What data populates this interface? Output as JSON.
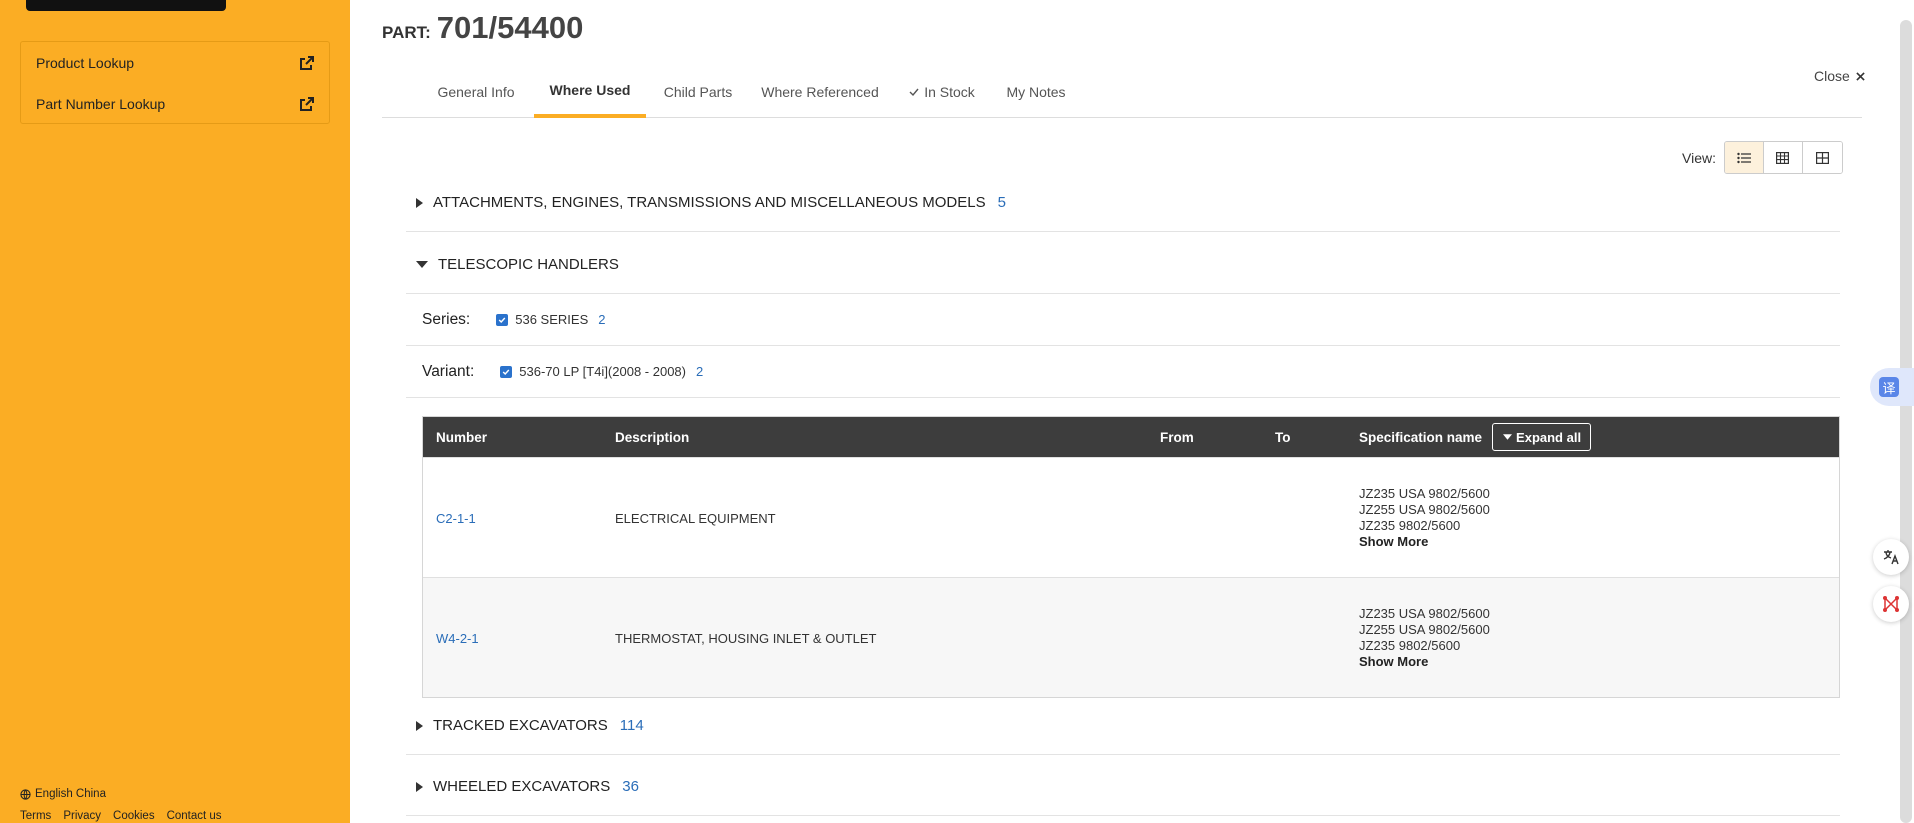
{
  "sidebar": {
    "links": [
      {
        "label": "Product Lookup"
      },
      {
        "label": "Part Number Lookup"
      }
    ],
    "language": "English China",
    "footer_links": [
      "Terms",
      "Privacy",
      "Cookies",
      "Contact us"
    ]
  },
  "part": {
    "prefix": "PART:",
    "number": "701/54400"
  },
  "tabs": [
    {
      "label": "General Info"
    },
    {
      "label": "Where Used"
    },
    {
      "label": "Child Parts"
    },
    {
      "label": "Where Referenced"
    },
    {
      "label": "In Stock"
    },
    {
      "label": "My Notes"
    }
  ],
  "close_label": "Close",
  "view_label": "View:",
  "sections": [
    {
      "title": "ATTACHMENTS, ENGINES, TRANSMISSIONS AND MISCELLANEOUS MODELS",
      "count": "5"
    },
    {
      "title": "TELESCOPIC HANDLERS",
      "count": ""
    },
    {
      "title": "TRACKED EXCAVATORS",
      "count": "114"
    },
    {
      "title": "WHEELED EXCAVATORS",
      "count": "36"
    }
  ],
  "filters": {
    "series": {
      "label": "Series:",
      "value": "536 SERIES",
      "count": "2"
    },
    "variant": {
      "label": "Variant:",
      "value": "536-70 LP [T4i](2008 - 2008)",
      "count": "2"
    }
  },
  "table": {
    "headers": {
      "number": "Number",
      "description": "Description",
      "from": "From",
      "to": "To",
      "spec": "Specification name"
    },
    "expand_all": "Expand all",
    "rows": [
      {
        "number": "C2-1-1",
        "description": "ELECTRICAL EQUIPMENT",
        "specs": [
          "JZ235 USA 9802/5600",
          "JZ255 USA 9802/5600",
          "JZ235 9802/5600"
        ],
        "show_more": "Show More"
      },
      {
        "number": "W4-2-1",
        "description": "THERMOSTAT, HOUSING INLET & OUTLET",
        "specs": [
          "JZ235 USA 9802/5600",
          "JZ255 USA 9802/5600",
          "JZ235 9802/5600"
        ],
        "show_more": "Show More"
      }
    ]
  },
  "translate_glyph": "译",
  "colors": {
    "brand": "#fbad24",
    "link": "#2a6db8",
    "table_header": "#3d3d3d"
  }
}
